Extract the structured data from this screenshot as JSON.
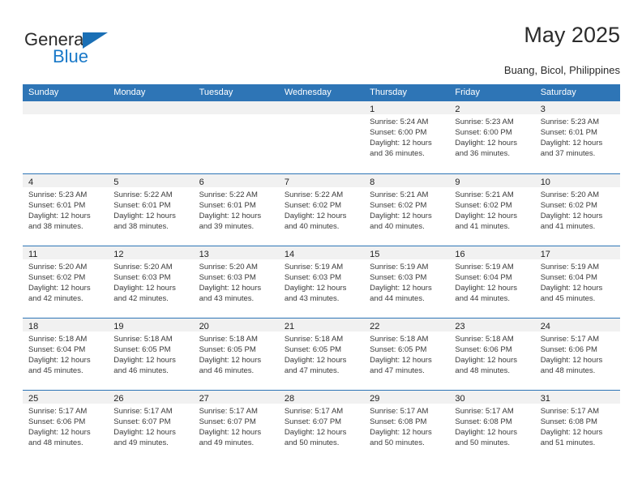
{
  "brand": {
    "word_one": "General",
    "word_two": "Blue",
    "flag_icon": "triangle-flag-icon"
  },
  "header": {
    "title": "May 2025",
    "location": "Buang, Bicol, Philippines"
  },
  "calendar": {
    "weekdays": [
      "Sunday",
      "Monday",
      "Tuesday",
      "Wednesday",
      "Thursday",
      "Friday",
      "Saturday"
    ],
    "accent_color": "#2e75b6",
    "day_band_color": "#f1f1f1",
    "weeks": [
      [
        {
          "day": "",
          "lines": []
        },
        {
          "day": "",
          "lines": []
        },
        {
          "day": "",
          "lines": []
        },
        {
          "day": "",
          "lines": []
        },
        {
          "day": "1",
          "lines": [
            "Sunrise: 5:24 AM",
            "Sunset: 6:00 PM",
            "Daylight: 12 hours",
            "and 36 minutes."
          ]
        },
        {
          "day": "2",
          "lines": [
            "Sunrise: 5:23 AM",
            "Sunset: 6:00 PM",
            "Daylight: 12 hours",
            "and 36 minutes."
          ]
        },
        {
          "day": "3",
          "lines": [
            "Sunrise: 5:23 AM",
            "Sunset: 6:01 PM",
            "Daylight: 12 hours",
            "and 37 minutes."
          ]
        }
      ],
      [
        {
          "day": "4",
          "lines": [
            "Sunrise: 5:23 AM",
            "Sunset: 6:01 PM",
            "Daylight: 12 hours",
            "and 38 minutes."
          ]
        },
        {
          "day": "5",
          "lines": [
            "Sunrise: 5:22 AM",
            "Sunset: 6:01 PM",
            "Daylight: 12 hours",
            "and 38 minutes."
          ]
        },
        {
          "day": "6",
          "lines": [
            "Sunrise: 5:22 AM",
            "Sunset: 6:01 PM",
            "Daylight: 12 hours",
            "and 39 minutes."
          ]
        },
        {
          "day": "7",
          "lines": [
            "Sunrise: 5:22 AM",
            "Sunset: 6:02 PM",
            "Daylight: 12 hours",
            "and 40 minutes."
          ]
        },
        {
          "day": "8",
          "lines": [
            "Sunrise: 5:21 AM",
            "Sunset: 6:02 PM",
            "Daylight: 12 hours",
            "and 40 minutes."
          ]
        },
        {
          "day": "9",
          "lines": [
            "Sunrise: 5:21 AM",
            "Sunset: 6:02 PM",
            "Daylight: 12 hours",
            "and 41 minutes."
          ]
        },
        {
          "day": "10",
          "lines": [
            "Sunrise: 5:20 AM",
            "Sunset: 6:02 PM",
            "Daylight: 12 hours",
            "and 41 minutes."
          ]
        }
      ],
      [
        {
          "day": "11",
          "lines": [
            "Sunrise: 5:20 AM",
            "Sunset: 6:02 PM",
            "Daylight: 12 hours",
            "and 42 minutes."
          ]
        },
        {
          "day": "12",
          "lines": [
            "Sunrise: 5:20 AM",
            "Sunset: 6:03 PM",
            "Daylight: 12 hours",
            "and 42 minutes."
          ]
        },
        {
          "day": "13",
          "lines": [
            "Sunrise: 5:20 AM",
            "Sunset: 6:03 PM",
            "Daylight: 12 hours",
            "and 43 minutes."
          ]
        },
        {
          "day": "14",
          "lines": [
            "Sunrise: 5:19 AM",
            "Sunset: 6:03 PM",
            "Daylight: 12 hours",
            "and 43 minutes."
          ]
        },
        {
          "day": "15",
          "lines": [
            "Sunrise: 5:19 AM",
            "Sunset: 6:03 PM",
            "Daylight: 12 hours",
            "and 44 minutes."
          ]
        },
        {
          "day": "16",
          "lines": [
            "Sunrise: 5:19 AM",
            "Sunset: 6:04 PM",
            "Daylight: 12 hours",
            "and 44 minutes."
          ]
        },
        {
          "day": "17",
          "lines": [
            "Sunrise: 5:19 AM",
            "Sunset: 6:04 PM",
            "Daylight: 12 hours",
            "and 45 minutes."
          ]
        }
      ],
      [
        {
          "day": "18",
          "lines": [
            "Sunrise: 5:18 AM",
            "Sunset: 6:04 PM",
            "Daylight: 12 hours",
            "and 45 minutes."
          ]
        },
        {
          "day": "19",
          "lines": [
            "Sunrise: 5:18 AM",
            "Sunset: 6:05 PM",
            "Daylight: 12 hours",
            "and 46 minutes."
          ]
        },
        {
          "day": "20",
          "lines": [
            "Sunrise: 5:18 AM",
            "Sunset: 6:05 PM",
            "Daylight: 12 hours",
            "and 46 minutes."
          ]
        },
        {
          "day": "21",
          "lines": [
            "Sunrise: 5:18 AM",
            "Sunset: 6:05 PM",
            "Daylight: 12 hours",
            "and 47 minutes."
          ]
        },
        {
          "day": "22",
          "lines": [
            "Sunrise: 5:18 AM",
            "Sunset: 6:05 PM",
            "Daylight: 12 hours",
            "and 47 minutes."
          ]
        },
        {
          "day": "23",
          "lines": [
            "Sunrise: 5:18 AM",
            "Sunset: 6:06 PM",
            "Daylight: 12 hours",
            "and 48 minutes."
          ]
        },
        {
          "day": "24",
          "lines": [
            "Sunrise: 5:17 AM",
            "Sunset: 6:06 PM",
            "Daylight: 12 hours",
            "and 48 minutes."
          ]
        }
      ],
      [
        {
          "day": "25",
          "lines": [
            "Sunrise: 5:17 AM",
            "Sunset: 6:06 PM",
            "Daylight: 12 hours",
            "and 48 minutes."
          ]
        },
        {
          "day": "26",
          "lines": [
            "Sunrise: 5:17 AM",
            "Sunset: 6:07 PM",
            "Daylight: 12 hours",
            "and 49 minutes."
          ]
        },
        {
          "day": "27",
          "lines": [
            "Sunrise: 5:17 AM",
            "Sunset: 6:07 PM",
            "Daylight: 12 hours",
            "and 49 minutes."
          ]
        },
        {
          "day": "28",
          "lines": [
            "Sunrise: 5:17 AM",
            "Sunset: 6:07 PM",
            "Daylight: 12 hours",
            "and 50 minutes."
          ]
        },
        {
          "day": "29",
          "lines": [
            "Sunrise: 5:17 AM",
            "Sunset: 6:08 PM",
            "Daylight: 12 hours",
            "and 50 minutes."
          ]
        },
        {
          "day": "30",
          "lines": [
            "Sunrise: 5:17 AM",
            "Sunset: 6:08 PM",
            "Daylight: 12 hours",
            "and 50 minutes."
          ]
        },
        {
          "day": "31",
          "lines": [
            "Sunrise: 5:17 AM",
            "Sunset: 6:08 PM",
            "Daylight: 12 hours",
            "and 51 minutes."
          ]
        }
      ]
    ]
  }
}
